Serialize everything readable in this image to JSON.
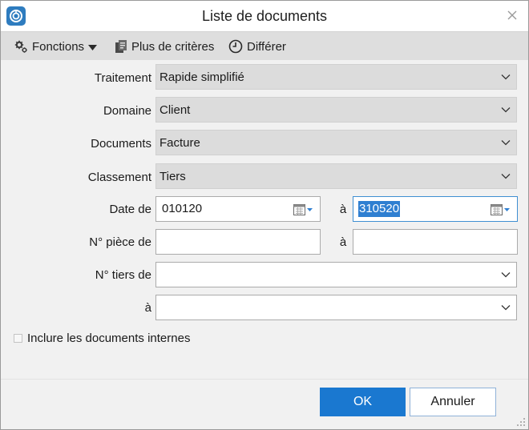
{
  "window": {
    "title": "Liste de documents"
  },
  "icons": {
    "app": "app-logo-icon",
    "close": "close-icon",
    "functions": "gear-icon",
    "criteria": "filter-icon",
    "defer": "clock-icon",
    "dropdown": "chevron-down-icon",
    "calendar": "calendar-icon"
  },
  "toolbar": {
    "functions_label": "Fonctions",
    "criteria_label": "Plus de critères",
    "defer_label": "Différer"
  },
  "form": {
    "traitement": {
      "label": "Traitement",
      "value": "Rapide simplifié"
    },
    "domaine": {
      "label": "Domaine",
      "value": "Client"
    },
    "documents": {
      "label": "Documents",
      "value": "Facture"
    },
    "classement": {
      "label": "Classement",
      "value": "Tiers"
    },
    "date": {
      "label": "Date de",
      "from": "010120",
      "to_label": "à",
      "to": "310520"
    },
    "piece": {
      "label": "N° pièce de",
      "from": "",
      "to_label": "à",
      "to": ""
    },
    "tiers": {
      "label": "N° tiers de",
      "from": "",
      "to_label": "à",
      "to": ""
    }
  },
  "checkbox": {
    "label": "Inclure les documents internes",
    "checked": false
  },
  "buttons": {
    "ok": "OK",
    "cancel": "Annuler"
  },
  "colors": {
    "accent": "#1a78d0",
    "selection": "#2f7fd1",
    "toolbar": "#dedede"
  }
}
